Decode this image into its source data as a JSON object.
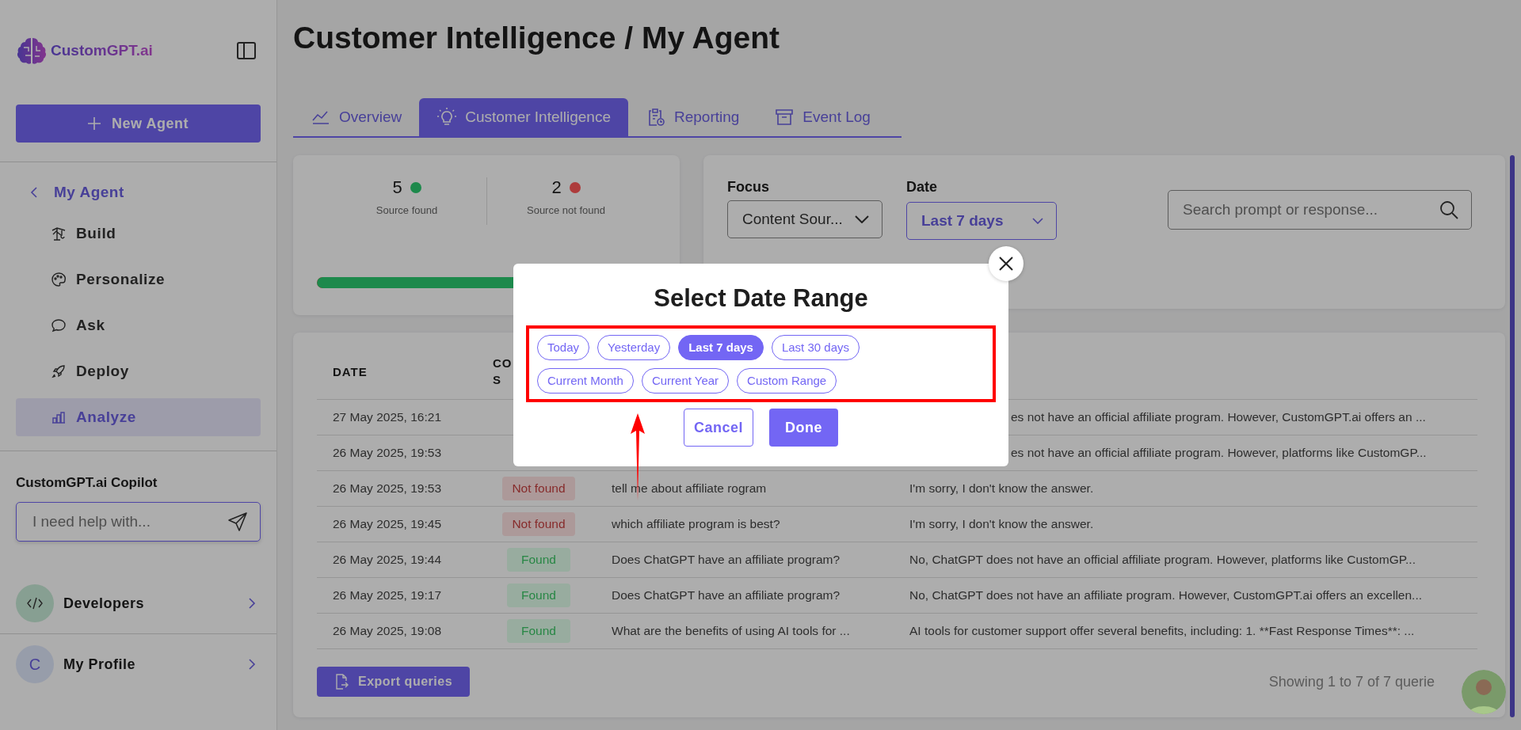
{
  "sidebar": {
    "logo_text": "CustomGPT.ai",
    "new_button": "New Agent",
    "back_label": "My Agent",
    "items": [
      {
        "label": "Build",
        "selected": false
      },
      {
        "label": "Personalize",
        "selected": false
      },
      {
        "label": "Ask",
        "selected": false
      },
      {
        "label": "Deploy",
        "selected": false
      },
      {
        "label": "Analyze",
        "selected": true
      }
    ],
    "copilot_title": "CustomGPT.ai Copilot",
    "copilot_placeholder": "I need help with...",
    "developers": "Developers",
    "profile_initial": "C",
    "profile": "My Profile"
  },
  "page_title": "Customer Intelligence / My Agent",
  "tabs": [
    {
      "label": "Overview",
      "selected": false
    },
    {
      "label": "Customer Intelligence",
      "selected": true
    },
    {
      "label": "Reporting",
      "selected": false
    },
    {
      "label": "Event Log",
      "selected": false
    }
  ],
  "stats": [
    {
      "value": "5",
      "label": "Source found",
      "color": "#1e8a4c"
    },
    {
      "value": "2",
      "label": "Source not found",
      "color": "#b03c3c"
    }
  ],
  "progress": {
    "level": 0.71
  },
  "filters": {
    "focus_label": "Focus",
    "focus_value": "Content Sour...",
    "date_label": "Date",
    "date_value": "Last 7 days",
    "search_placeholder": "Search prompt or response..."
  },
  "table": {
    "columns": [
      "DATE",
      "CO\nS"
    ],
    "rows": [
      {
        "date": "27 May 2025, 16:21",
        "response": "es not have an official affiliate program. However, CustomGPT.ai offers an ...",
        "kind": "partial"
      },
      {
        "date": "26 May 2025, 19:53",
        "response": "es not have an official affiliate program. However, platforms like CustomGP...",
        "kind": "partial"
      },
      {
        "date": "26 May 2025, 19:53",
        "status": {
          "label": "Not found",
          "color": "#ad9a9a"
        },
        "prompt": "tell me about affiliate rogram",
        "response": "I'm sorry, I don't know the answer.",
        "kind": "full"
      },
      {
        "date": "26 May 2025, 19:45",
        "status": {
          "label": "Not found",
          "color": "#ad9a9a"
        },
        "prompt": "which affiliate program is best?",
        "response": "I'm sorry, I don't know the answer.",
        "kind": "full"
      },
      {
        "date": "26 May 2025, 19:44",
        "status": {
          "label": "Found",
          "color": "#99ad9f"
        },
        "prompt": "Does ChatGPT have an affiliate program?",
        "response": "No, ChatGPT does not have an official affiliate program. However, platforms like CustomGP...",
        "kind": "full"
      },
      {
        "date": "26 May 2025, 19:17",
        "status": {
          "label": "Found",
          "color": "#99ad9f"
        },
        "prompt": "Does ChatGPT have an affiliate program?",
        "response": "No, ChatGPT does not have an affiliate program. However, CustomGPT.ai offers an excellen...",
        "kind": "full"
      },
      {
        "date": "26 May 2025, 19:08",
        "status": {
          "label": "Found",
          "color": "#99ad9f"
        },
        "prompt": "What are the benefits of using AI tools for ...",
        "response": "AI tools for customer support offer several benefits, including: 1. **Fast Response Times**: ...",
        "kind": "full"
      }
    ],
    "export_button": "Export queries",
    "footer": "Showing 1 to 7 of 7 querie"
  },
  "modal": {
    "title": "Select Date Range",
    "options": [
      {
        "label": "Today",
        "selected": false
      },
      {
        "label": "Yesterday",
        "selected": false
      },
      {
        "label": "Last 7 days",
        "selected": true
      },
      {
        "label": "Last 30 days",
        "selected": false
      },
      {
        "label": "Current Month",
        "selected": false
      },
      {
        "label": "Current Year",
        "selected": false
      },
      {
        "label": "Custom Range",
        "selected": false
      }
    ],
    "cancel": "Cancel",
    "done": "Done"
  }
}
